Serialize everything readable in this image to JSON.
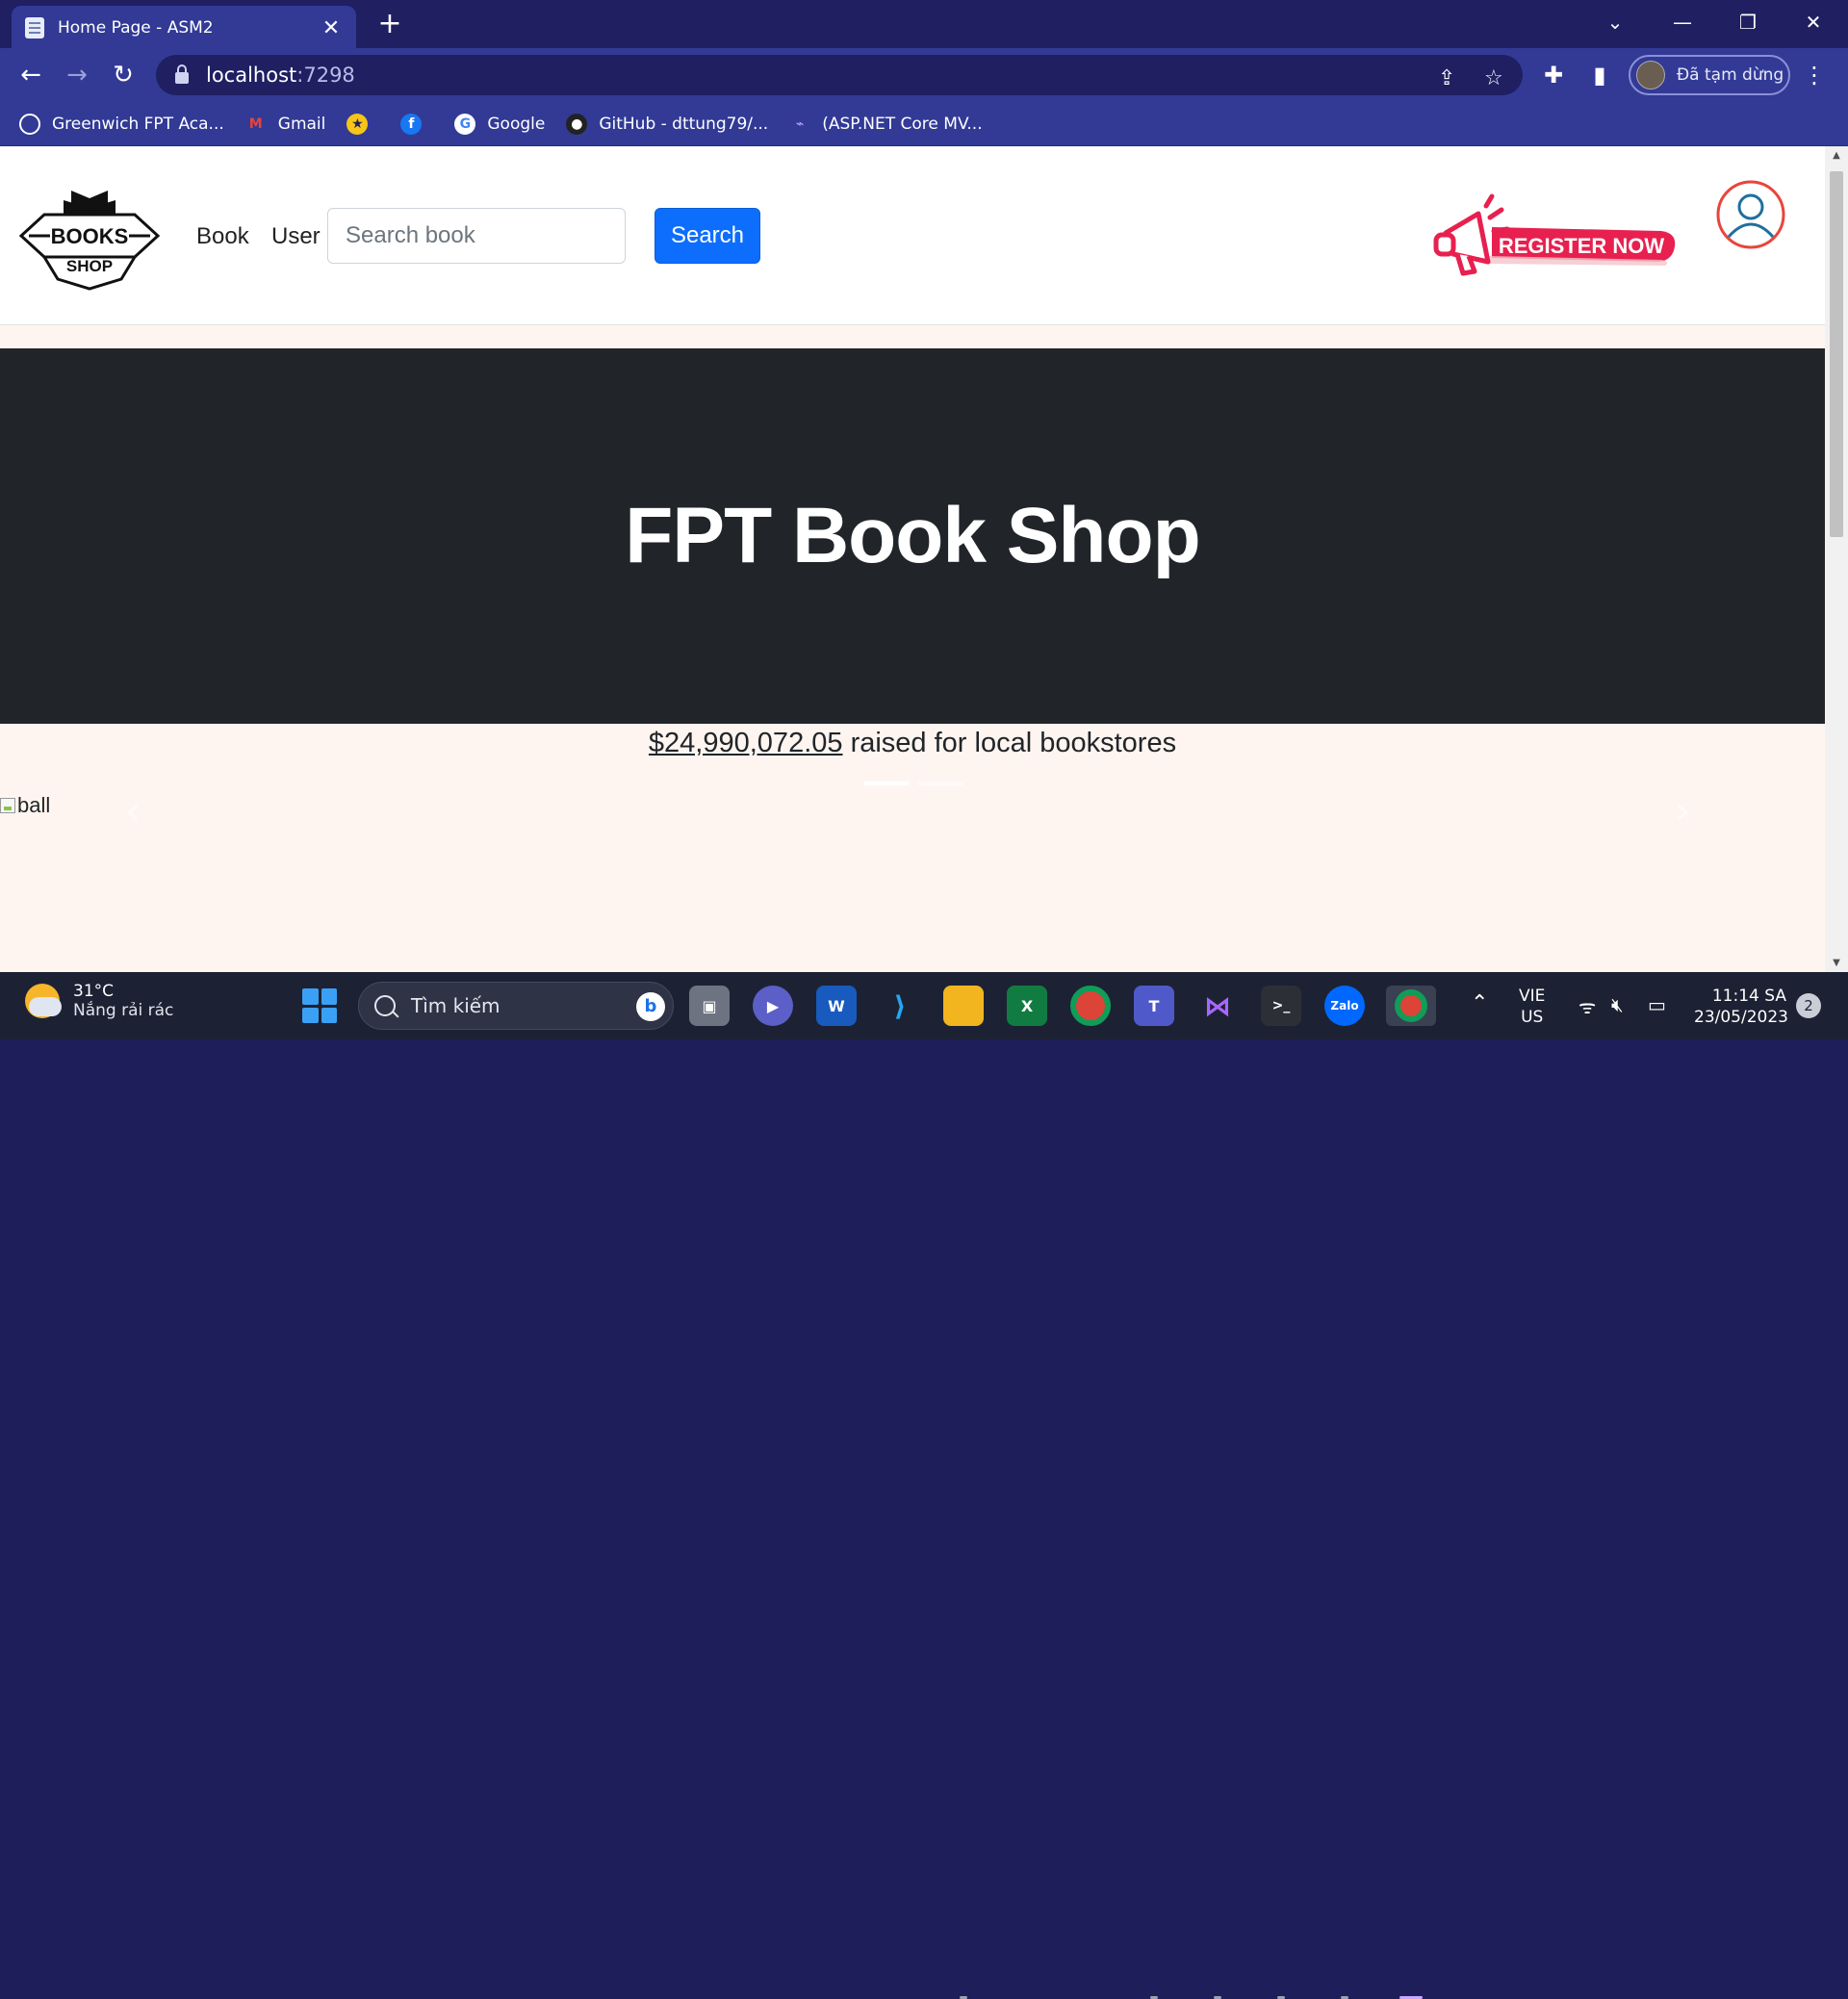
{
  "browser": {
    "tab_title": "Home Page - ASM2",
    "tab_close": "✕",
    "new_tab": "+",
    "url_host": "localhost",
    "url_port": ":7298",
    "profile_label": "Đã tạm dừng",
    "bookmarks": [
      {
        "label": "Greenwich FPT Aca...",
        "icon": "greenwich-icon",
        "color": "#ffffff"
      },
      {
        "label": "Gmail",
        "icon": "gmail-icon",
        "color": "#ea4335"
      },
      {
        "label": "",
        "icon": "ankhang-icon",
        "color": "#f5c518"
      },
      {
        "label": "",
        "icon": "facebook-icon",
        "color": "#1877f2"
      },
      {
        "label": "Google",
        "icon": "google-icon",
        "color": "#ffffff"
      },
      {
        "label": "GitHub - dttung79/...",
        "icon": "github-icon",
        "color": "#222222"
      },
      {
        "label": "(ASP.NET Core MV...",
        "icon": "aspnet-icon",
        "color": "#7a5cff"
      }
    ]
  },
  "site": {
    "logo_text_top": "BOOKS",
    "logo_text_bottom": "SHOP",
    "nav": [
      "Book",
      "User"
    ],
    "search_placeholder": "Search book",
    "search_button": "Search",
    "register_label": "REGISTER NOW",
    "hero_title": "FPT Book Shop",
    "raised_amount": "$24,990,072.05",
    "raised_text": " raised for local bookstores",
    "carousel_img_alt": "ball"
  },
  "taskbar": {
    "temperature": "31°C",
    "weather": "Nắng rải rác",
    "search_placeholder": "Tìm kiếm",
    "lang_top": "VIE",
    "lang_bottom": "US",
    "time": "11:14 SA",
    "date": "23/05/2023",
    "notifications": "2"
  },
  "colors": {
    "browser_frame": "#1f1f62",
    "browser_toolbar": "#323a96",
    "primary_button": "#0d6efd",
    "hero_bg": "#212529",
    "page_bg": "#fff5f0",
    "register_accent": "#e8204f"
  }
}
